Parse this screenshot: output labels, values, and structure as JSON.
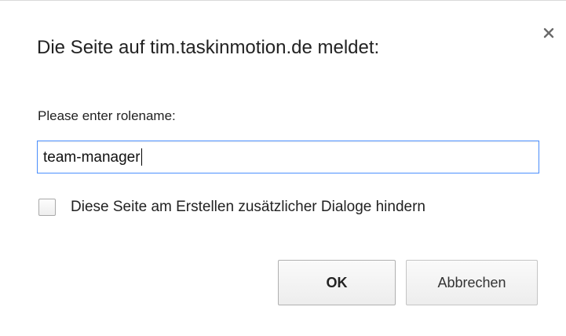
{
  "dialog": {
    "title": "Die Seite auf tim.taskinmotion.de meldet:",
    "close_icon": "close-icon",
    "prompt_label": "Please enter rolename:",
    "input_value": "team-manager",
    "suppress_label": "Diese Seite am Erstellen zusätzlicher Dialoge hindern",
    "suppress_checked": false,
    "ok_label": "OK",
    "cancel_label": "Abbrechen",
    "colors": {
      "focus_border": "#4d90fe",
      "background": "#ffffff",
      "text": "#222222"
    }
  }
}
